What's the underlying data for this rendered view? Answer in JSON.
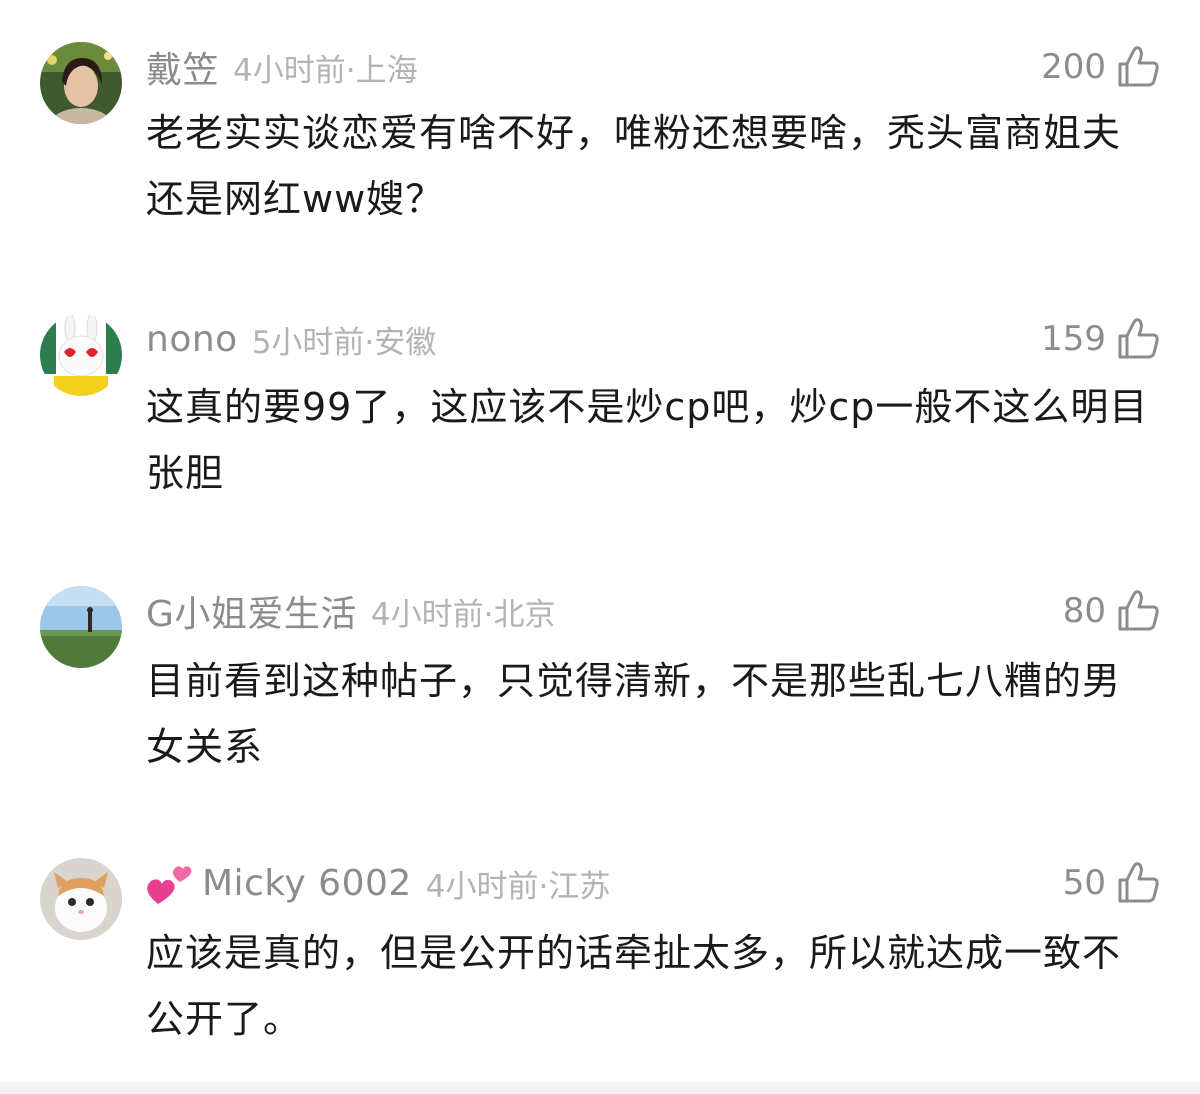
{
  "comments": [
    {
      "username": "戴笠",
      "time_location": "4小时前·上海",
      "likes": "200",
      "text": "老老实实谈恋爱有啥不好，唯粉还想要啥，秃头富商姐夫还是网红ww嫂？"
    },
    {
      "username": "nono",
      "time_location": "5小时前·安徽",
      "likes": "159",
      "text": "这真的要99了，这应该不是炒cp吧，炒cp一般不这么明目张胆"
    },
    {
      "username": "G小姐爱生活",
      "time_location": "4小时前·北京",
      "likes": "80",
      "text": "目前看到这种帖子，只觉得清新，不是那些乱七八糟的男女关系"
    },
    {
      "username": "Micky 6002",
      "time_location": "4小时前·江苏",
      "likes": "50",
      "text": "应该是真的，但是公开的话牵扯太多，所以就达成一致不公开了。",
      "badge_icon": "two-hearts-icon"
    }
  ],
  "icons": {
    "like": "thumbs-up-icon"
  },
  "colors": {
    "username": "#8c8c8c",
    "meta": "#b3b3b3",
    "text": "#1a1a1a",
    "badge": "#e8408f"
  }
}
